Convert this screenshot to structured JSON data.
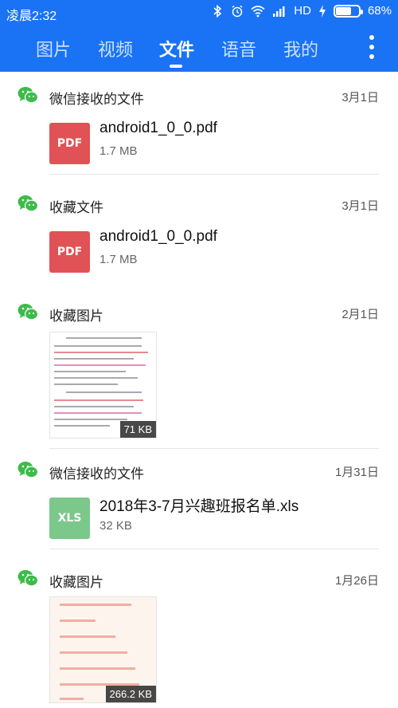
{
  "status": {
    "time": "凌晨2:32",
    "network": "HD",
    "battery": "68%",
    "battery_level": 0.68
  },
  "tabs": [
    {
      "label": "图片"
    },
    {
      "label": "视频"
    },
    {
      "label": "文件",
      "active": true
    },
    {
      "label": "语音"
    },
    {
      "label": "我的"
    }
  ],
  "groups": [
    {
      "title": "微信接收的文件",
      "date": "3月1日",
      "icon": "wechat-icon",
      "file": {
        "type": "PDF",
        "name": "android1_0_0.pdf",
        "size": "1.7 MB",
        "color": "#e05256"
      }
    },
    {
      "title": "收藏文件",
      "date": "3月1日",
      "icon": "wechat-icon",
      "file": {
        "type": "PDF",
        "name": "android1_0_0.pdf",
        "size": "1.7 MB",
        "color": "#e05256"
      }
    },
    {
      "title": "收藏图片",
      "date": "2月1日",
      "icon": "wechat-icon",
      "image": {
        "size": "71 KB"
      }
    },
    {
      "title": "微信接收的文件",
      "date": "1月31日",
      "icon": "wechat-icon",
      "file": {
        "type": "XLS",
        "name": "2018年3-7月兴趣班报名单.xls",
        "size": "32 KB",
        "color": "#7bc88a"
      }
    },
    {
      "title": "收藏图片",
      "date": "1月26日",
      "icon": "wechat-icon",
      "image": {
        "size": "266.2 KB"
      }
    }
  ],
  "colors": {
    "brand_blue": "#1a73f5",
    "wechat_green": "#3dbb4a"
  }
}
